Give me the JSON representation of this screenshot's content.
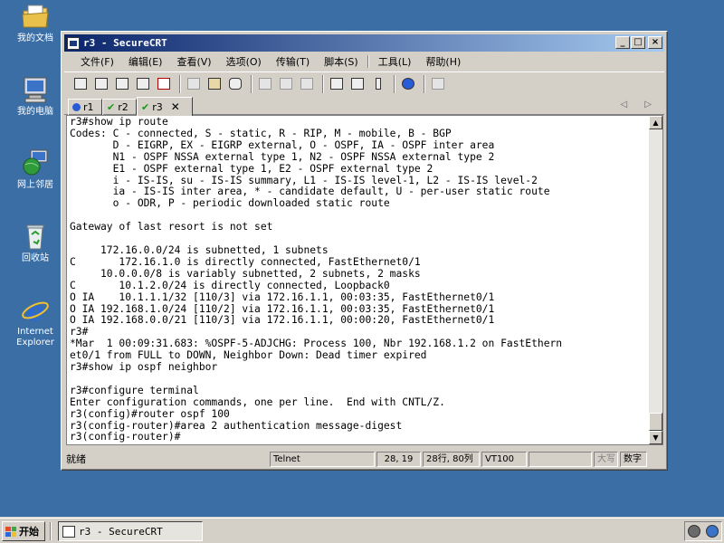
{
  "desktop": {
    "icons": [
      {
        "name": "my-documents",
        "label": "我的文档"
      },
      {
        "name": "my-computer",
        "label": "我的电脑"
      },
      {
        "name": "network-places",
        "label": "网上邻居"
      },
      {
        "name": "recycle-bin",
        "label": "回收站"
      },
      {
        "name": "internet-explorer",
        "label_line1": "Internet",
        "label_line2": "Explorer"
      }
    ]
  },
  "window": {
    "title": "r3 - SecureCRT",
    "buttons": {
      "minimize": "_",
      "maximize": "□",
      "close": "×"
    }
  },
  "menu": [
    "文件(F)",
    "编辑(E)",
    "查看(V)",
    "选项(O)",
    "传输(T)",
    "脚本(S)",
    "工具(L)",
    "帮助(H)"
  ],
  "tabs": [
    {
      "label": "r1",
      "status": "connecting"
    },
    {
      "label": "r2",
      "status": "connected"
    },
    {
      "label": "r3",
      "status": "connected",
      "active": true
    }
  ],
  "tab_close": "✕",
  "tab_nav": "◁ ▷",
  "terminal": {
    "lines": [
      "r3#show ip route",
      "Codes: C - connected, S - static, R - RIP, M - mobile, B - BGP",
      "       D - EIGRP, EX - EIGRP external, O - OSPF, IA - OSPF inter area",
      "       N1 - OSPF NSSA external type 1, N2 - OSPF NSSA external type 2",
      "       E1 - OSPF external type 1, E2 - OSPF external type 2",
      "       i - IS-IS, su - IS-IS summary, L1 - IS-IS level-1, L2 - IS-IS level-2",
      "       ia - IS-IS inter area, * - candidate default, U - per-user static route",
      "       o - ODR, P - periodic downloaded static route",
      "",
      "Gateway of last resort is not set",
      "",
      "     172.16.0.0/24 is subnetted, 1 subnets",
      "C       172.16.1.0 is directly connected, FastEthernet0/1",
      "     10.0.0.0/8 is variably subnetted, 2 subnets, 2 masks",
      "C       10.1.2.0/24 is directly connected, Loopback0",
      "O IA    10.1.1.1/32 [110/3] via 172.16.1.1, 00:03:35, FastEthernet0/1",
      "O IA 192.168.1.0/24 [110/2] via 172.16.1.1, 00:03:35, FastEthernet0/1",
      "O IA 192.168.0.0/21 [110/3] via 172.16.1.1, 00:00:20, FastEthernet0/1",
      "r3#",
      "*Mar  1 00:09:31.683: %OSPF-5-ADJCHG: Process 100, Nbr 192.168.1.2 on FastEthern",
      "et0/1 from FULL to DOWN, Neighbor Down: Dead timer expired",
      "r3#show ip ospf neighbor",
      "",
      "r3#configure terminal",
      "Enter configuration commands, one per line.  End with CNTL/Z.",
      "r3(config)#router ospf 100",
      "r3(config-router)#area 2 authentication message-digest",
      "r3(config-router)#"
    ]
  },
  "statusbar": {
    "ready": "就绪",
    "protocol": "Telnet",
    "cursor": "28, 19",
    "size": "28行, 80列",
    "emulation": "VT100",
    "empty": "",
    "caps": "大写",
    "num": "数字"
  },
  "taskbar": {
    "start": "开始",
    "task_title": "r3 - SecureCRT"
  }
}
